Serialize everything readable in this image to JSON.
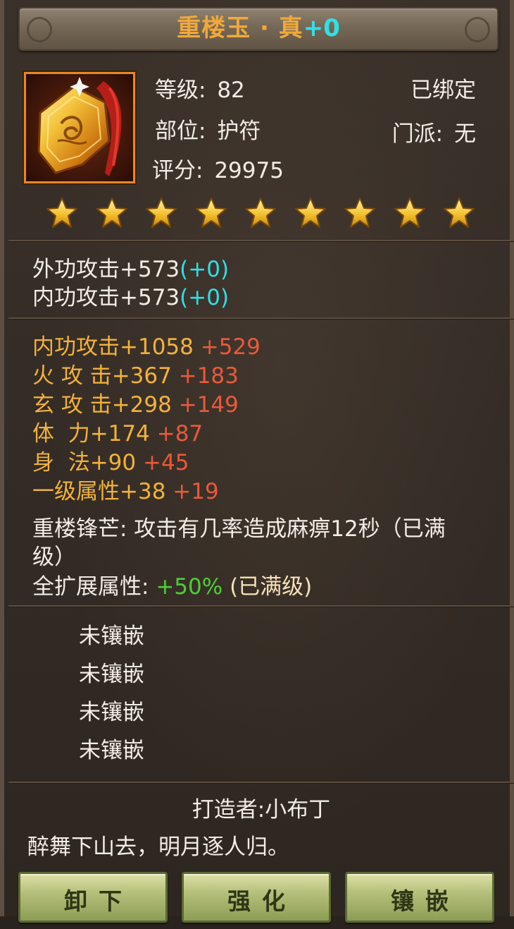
{
  "header": {
    "item_name": "重楼玉 · 真",
    "enhance_level": "+0"
  },
  "info": {
    "level_label": "等级:",
    "level_value": "82",
    "slot_label": "部位:",
    "slot_value": "护符",
    "score_label": "评分:",
    "score_value": "29975",
    "bound_status": "已绑定",
    "sect_label": "门派:",
    "sect_value": "无"
  },
  "stars": {
    "count": 9,
    "color": "#f5c12e"
  },
  "base_stats": [
    {
      "name": "外功攻击+573",
      "bonus": "(+0)"
    },
    {
      "name": "内功攻击+573",
      "bonus": "(+0)"
    }
  ],
  "extra_stats": [
    {
      "name": "内功攻击+1058",
      "bonus": "+529"
    },
    {
      "name": "火 攻 击+367",
      "bonus": "+183"
    },
    {
      "name": "玄 攻 击+298",
      "bonus": "+149"
    },
    {
      "name": "体  力+174",
      "bonus": "+87"
    },
    {
      "name": "身  法+90",
      "bonus": "+45"
    },
    {
      "name": "一级属性+38",
      "bonus": "+19"
    }
  ],
  "special": {
    "line1": "重楼锋芒: 攻击有几率造成麻痹12秒（已满",
    "line2": "级）",
    "expand_label": "全扩展属性:",
    "expand_value": "+50%",
    "expand_status": "(已满级)"
  },
  "gem_slots": [
    "未镶嵌",
    "未镶嵌",
    "未镶嵌",
    "未镶嵌"
  ],
  "maker": "打造者:小布丁",
  "quote": "醉舞下山去，明月逐人归。",
  "buttons": {
    "unequip": "卸下",
    "enhance": "强化",
    "inlay": "镶嵌"
  },
  "colors": {
    "title": "#f0a93a",
    "cyan": "#31dfe6",
    "gold": "#f3b23a",
    "red": "#e85a3a",
    "green": "#4ccf37",
    "icon_border": "#e58a1e"
  }
}
